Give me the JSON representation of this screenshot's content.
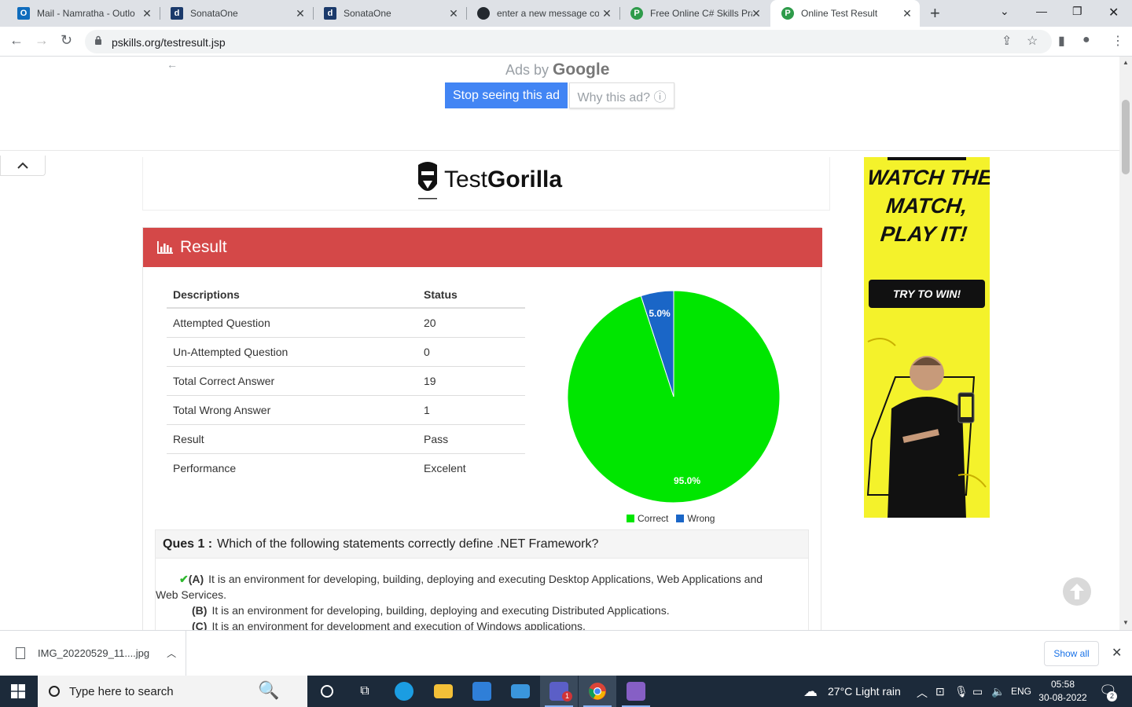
{
  "browser": {
    "tabs": [
      {
        "title": "Mail - Namratha - Outlo",
        "favicon": "outlook-icon",
        "color": "#0f6cbd",
        "letter": "O"
      },
      {
        "title": "SonataOne",
        "favicon": "sonataone-icon",
        "color": "#1b3a6b",
        "letter": "d"
      },
      {
        "title": "SonataOne",
        "favicon": "sonataone-icon",
        "color": "#1b3a6b",
        "letter": "d"
      },
      {
        "title": "enter a new message co",
        "favicon": "github-icon",
        "color": "#24292f",
        "letter": ""
      },
      {
        "title": "Free Online C# Skills Pra",
        "favicon": "pskills-icon",
        "color": "#2e9b4a",
        "letter": "P"
      },
      {
        "title": "Online Test Result",
        "favicon": "pskills-icon",
        "color": "#2e9b4a",
        "letter": "P"
      }
    ],
    "url": "pskills.org/testresult.jsp"
  },
  "ad_top": {
    "ads_by": "Ads by",
    "google": "Google",
    "stop_label": "Stop seeing this ad",
    "why_label": "Why this ad? ⓘ"
  },
  "logo": {
    "test": "Test",
    "gorilla": "Gorilla"
  },
  "result": {
    "heading": "Result",
    "headers": [
      "Descriptions",
      "Status"
    ],
    "rows": [
      [
        "Attempted Question",
        "20"
      ],
      [
        "Un-Attempted Question",
        "0"
      ],
      [
        "Total Correct Answer",
        "19"
      ],
      [
        "Total Wrong Answer",
        "1"
      ],
      [
        "Result",
        "Pass"
      ],
      [
        "Performance",
        "Excelent"
      ]
    ]
  },
  "chart_data": {
    "type": "pie",
    "categories": [
      "Correct",
      "Wrong"
    ],
    "values": [
      95.0,
      5.0
    ],
    "labels": [
      "95.0%",
      "5.0%"
    ],
    "colors": [
      "#00e600",
      "#1a66c7"
    ],
    "legend_position": "bottom"
  },
  "question": {
    "prefix": "Ques 1 :",
    "text": "Which of the following statements correctly define .NET Framework?",
    "options": [
      {
        "key": "(A)",
        "text": "It is an environment for developing, building, deploying and executing Desktop Applications, Web Applications and",
        "cont": "Web Services.",
        "correct": true
      },
      {
        "key": "(B)",
        "text": "It is an environment for developing, building, deploying and executing Distributed Applications.",
        "cont": "",
        "correct": false
      },
      {
        "key": "(C)",
        "text": "It is an environment for development and execution of Windows applications.",
        "cont": "",
        "correct": false
      }
    ]
  },
  "side_ad": {
    "headline": [
      "WATCH THE",
      "MATCH,",
      "PLAY IT!"
    ],
    "button": "TRY TO WIN!"
  },
  "download": {
    "filename": "IMG_20220529_11....jpg",
    "show_all": "Show all"
  },
  "taskbar": {
    "search_placeholder": "Type here to search",
    "weather": "27°C  Light rain",
    "lang": "ENG",
    "time": "05:58",
    "date": "30-08-2022",
    "notif_count": "2",
    "teams_badge": "1"
  }
}
